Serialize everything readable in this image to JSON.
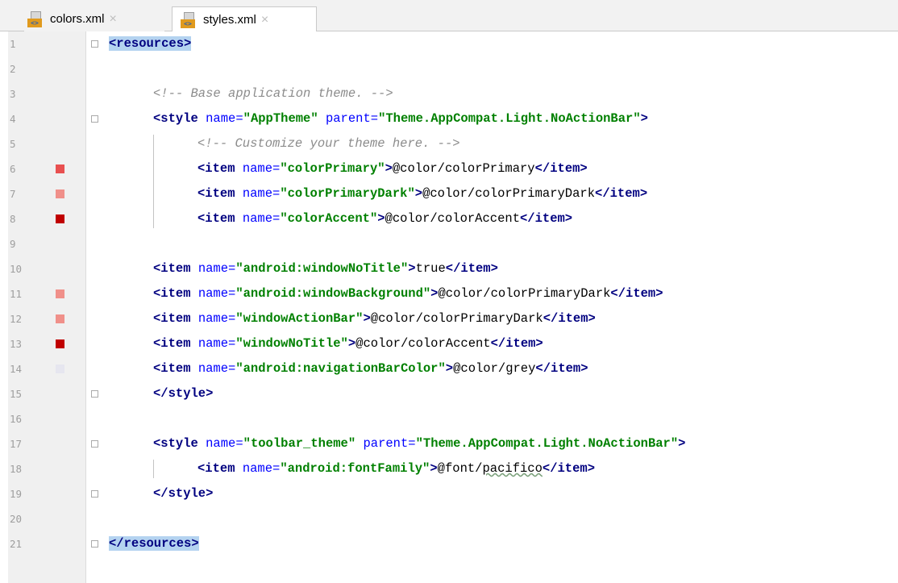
{
  "tabs": [
    {
      "label": "colors.xml",
      "active": false,
      "icon": "xml-file-icon"
    },
    {
      "label": "styles.xml",
      "active": true,
      "icon": "xml-file-icon"
    }
  ],
  "close_glyph": "×",
  "lines": [
    {
      "n": "1",
      "tokens": [
        {
          "t": "<resources>",
          "c": "tag hl"
        }
      ]
    },
    {
      "n": "2",
      "tokens": []
    },
    {
      "n": "3",
      "indent": 1,
      "tokens": [
        {
          "t": "<!-- Base application theme. -->",
          "c": "cmt"
        }
      ]
    },
    {
      "n": "4",
      "indent": 1,
      "tokens": [
        {
          "t": "<style ",
          "c": "tag"
        },
        {
          "t": "name=",
          "c": "attr"
        },
        {
          "t": "\"AppTheme\"",
          "c": "val"
        },
        {
          "t": " parent=",
          "c": "attr"
        },
        {
          "t": "\"Theme.AppCompat.Light.NoActionBar\"",
          "c": "val"
        },
        {
          "t": ">",
          "c": "tag"
        }
      ]
    },
    {
      "n": "5",
      "indent": 2,
      "tokens": [
        {
          "t": "<!-- Customize your theme here. -->",
          "c": "cmt"
        }
      ]
    },
    {
      "n": "6",
      "indent": 2,
      "swatch": "#e85050",
      "tokens": [
        {
          "t": "<item ",
          "c": "tag"
        },
        {
          "t": "name=",
          "c": "attr"
        },
        {
          "t": "\"colorPrimary\"",
          "c": "val"
        },
        {
          "t": ">",
          "c": "tag"
        },
        {
          "t": "@color/colorPrimary",
          "c": "txt"
        },
        {
          "t": "</item>",
          "c": "tag"
        }
      ]
    },
    {
      "n": "7",
      "indent": 2,
      "swatch": "#f0908a",
      "tokens": [
        {
          "t": "<item ",
          "c": "tag"
        },
        {
          "t": "name=",
          "c": "attr"
        },
        {
          "t": "\"colorPrimaryDark\"",
          "c": "val"
        },
        {
          "t": ">",
          "c": "tag"
        },
        {
          "t": "@color/colorPrimaryDark",
          "c": "txt"
        },
        {
          "t": "</item>",
          "c": "tag"
        }
      ]
    },
    {
      "n": "8",
      "indent": 2,
      "swatch": "#c00000",
      "tokens": [
        {
          "t": "<item ",
          "c": "tag"
        },
        {
          "t": "name=",
          "c": "attr"
        },
        {
          "t": "\"colorAccent\"",
          "c": "val"
        },
        {
          "t": ">",
          "c": "tag"
        },
        {
          "t": "@color/colorAccent",
          "c": "txt"
        },
        {
          "t": "</item>",
          "c": "tag"
        }
      ]
    },
    {
      "n": "9",
      "tokens": []
    },
    {
      "n": "10",
      "indent": 1,
      "tokens": [
        {
          "t": "<item ",
          "c": "tag"
        },
        {
          "t": "name=",
          "c": "attr"
        },
        {
          "t": "\"android:windowNoTitle\"",
          "c": "val"
        },
        {
          "t": ">",
          "c": "tag"
        },
        {
          "t": "true",
          "c": "txt"
        },
        {
          "t": "</item>",
          "c": "tag"
        }
      ]
    },
    {
      "n": "11",
      "indent": 1,
      "swatch": "#f0908a",
      "tokens": [
        {
          "t": "<item ",
          "c": "tag"
        },
        {
          "t": "name=",
          "c": "attr"
        },
        {
          "t": "\"android:windowBackground\"",
          "c": "val"
        },
        {
          "t": ">",
          "c": "tag"
        },
        {
          "t": "@color/colorPrimaryDark",
          "c": "txt"
        },
        {
          "t": "</item>",
          "c": "tag"
        }
      ]
    },
    {
      "n": "12",
      "indent": 1,
      "swatch": "#f0908a",
      "tokens": [
        {
          "t": "<item ",
          "c": "tag"
        },
        {
          "t": "name=",
          "c": "attr"
        },
        {
          "t": "\"windowActionBar\"",
          "c": "val"
        },
        {
          "t": ">",
          "c": "tag"
        },
        {
          "t": "@color/colorPrimaryDark",
          "c": "txt"
        },
        {
          "t": "</item>",
          "c": "tag"
        }
      ]
    },
    {
      "n": "13",
      "indent": 1,
      "swatch": "#c00000",
      "tokens": [
        {
          "t": "<item ",
          "c": "tag"
        },
        {
          "t": "name=",
          "c": "attr"
        },
        {
          "t": "\"windowNoTitle\"",
          "c": "val"
        },
        {
          "t": ">",
          "c": "tag"
        },
        {
          "t": "@color/colorAccent",
          "c": "txt"
        },
        {
          "t": "</item>",
          "c": "tag"
        }
      ]
    },
    {
      "n": "14",
      "indent": 1,
      "swatch": "#e6e6ef",
      "tokens": [
        {
          "t": "<item ",
          "c": "tag"
        },
        {
          "t": "name=",
          "c": "attr"
        },
        {
          "t": "\"android:navigationBarColor\"",
          "c": "val"
        },
        {
          "t": ">",
          "c": "tag"
        },
        {
          "t": "@color/grey",
          "c": "txt"
        },
        {
          "t": "</item>",
          "c": "tag"
        }
      ]
    },
    {
      "n": "15",
      "indent": 1,
      "tokens": [
        {
          "t": "</style>",
          "c": "tag"
        }
      ]
    },
    {
      "n": "16",
      "tokens": []
    },
    {
      "n": "17",
      "indent": 1,
      "tokens": [
        {
          "t": "<style ",
          "c": "tag"
        },
        {
          "t": "name=",
          "c": "attr"
        },
        {
          "t": "\"toolbar_theme\"",
          "c": "val"
        },
        {
          "t": " parent=",
          "c": "attr"
        },
        {
          "t": "\"Theme.AppCompat.Light.NoActionBar\"",
          "c": "val"
        },
        {
          "t": ">",
          "c": "tag"
        }
      ]
    },
    {
      "n": "18",
      "indent": 2,
      "tokens": [
        {
          "t": "<item ",
          "c": "tag"
        },
        {
          "t": "name=",
          "c": "attr"
        },
        {
          "t": "\"android:fontFamily\"",
          "c": "val"
        },
        {
          "t": ">",
          "c": "tag"
        },
        {
          "t": "@font/",
          "c": "txt"
        },
        {
          "t": "pacifico",
          "c": "txt squiggle"
        },
        {
          "t": "</item>",
          "c": "tag"
        }
      ]
    },
    {
      "n": "19",
      "indent": 1,
      "tokens": [
        {
          "t": "</style>",
          "c": "tag"
        }
      ]
    },
    {
      "n": "20",
      "tokens": []
    },
    {
      "n": "21",
      "tokens": [
        {
          "t": "</resources>",
          "c": "tag hl"
        }
      ]
    }
  ]
}
